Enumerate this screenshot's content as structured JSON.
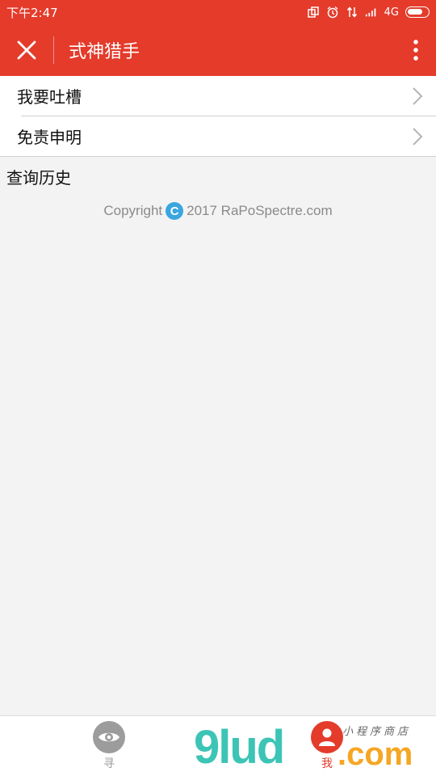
{
  "status_bar": {
    "time": "下午2:47",
    "network": "4G",
    "icons": [
      "screen-rotate-icon",
      "alarm-icon",
      "data-transfer-icon",
      "signal-icon",
      "battery-icon"
    ]
  },
  "app_bar": {
    "title": "式神猎手",
    "close_icon": "close-icon",
    "more_icon": "more-vert-icon",
    "color": "#e43b2b"
  },
  "menu": {
    "items": [
      {
        "label": "我要吐槽"
      },
      {
        "label": "免责申明"
      }
    ]
  },
  "history": {
    "title": "查询历史"
  },
  "footer": {
    "copyright_prefix": "Copyright",
    "copyright_symbol": "C",
    "copyright_text": "2017 RaPoSpectre.com"
  },
  "tabs": [
    {
      "label": "寻",
      "icon": "eye-icon",
      "active": false
    },
    {
      "label": "我",
      "icon": "user-icon",
      "active": true
    }
  ],
  "watermark": {
    "brand": "9lud",
    "domain": ".com",
    "tagline": "小程序商店"
  }
}
